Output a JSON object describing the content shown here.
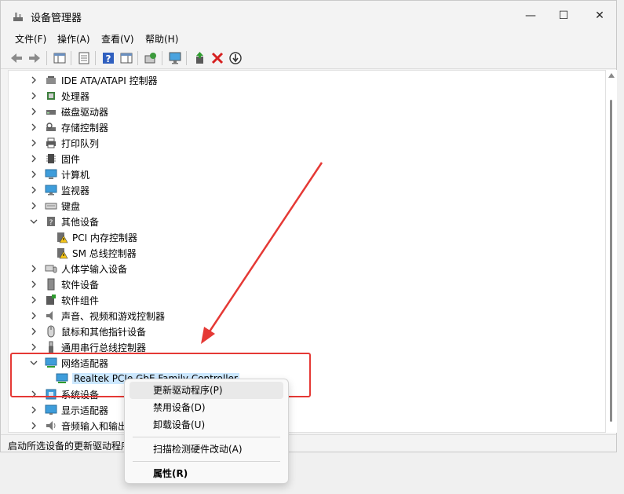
{
  "window": {
    "title": "设备管理器",
    "minimize": "—",
    "maximize": "☐",
    "close": "✕"
  },
  "menu": [
    "文件(F)",
    "操作(A)",
    "查看(V)",
    "帮助(H)"
  ],
  "tree": [
    {
      "label": "IDE ATA/ATAPI 控制器",
      "icon": "ide-controller-icon",
      "level": 0,
      "expanded": false
    },
    {
      "label": "处理器",
      "icon": "processor-icon",
      "level": 0,
      "expanded": false
    },
    {
      "label": "磁盘驱动器",
      "icon": "disk-drive-icon",
      "level": 0,
      "expanded": false
    },
    {
      "label": "存储控制器",
      "icon": "storage-controller-icon",
      "level": 0,
      "expanded": false
    },
    {
      "label": "打印队列",
      "icon": "printer-icon",
      "level": 0,
      "expanded": false
    },
    {
      "label": "固件",
      "icon": "firmware-icon",
      "level": 0,
      "expanded": false
    },
    {
      "label": "计算机",
      "icon": "computer-icon",
      "level": 0,
      "expanded": false
    },
    {
      "label": "监视器",
      "icon": "monitor-icon",
      "level": 0,
      "expanded": false
    },
    {
      "label": "键盘",
      "icon": "keyboard-icon",
      "level": 0,
      "expanded": false
    },
    {
      "label": "其他设备",
      "icon": "other-devices-icon",
      "level": 0,
      "expanded": true
    },
    {
      "label": "PCI 内存控制器",
      "icon": "warning-device-icon",
      "level": 1
    },
    {
      "label": "SM 总线控制器",
      "icon": "warning-device-icon",
      "level": 1
    },
    {
      "label": "人体学输入设备",
      "icon": "hid-icon",
      "level": 0,
      "expanded": false
    },
    {
      "label": "软件设备",
      "icon": "software-device-icon",
      "level": 0,
      "expanded": false
    },
    {
      "label": "软件组件",
      "icon": "software-component-icon",
      "level": 0,
      "expanded": false
    },
    {
      "label": "声音、视频和游戏控制器",
      "icon": "speaker-icon",
      "level": 0,
      "expanded": false
    },
    {
      "label": "鼠标和其他指针设备",
      "icon": "mouse-icon",
      "level": 0,
      "expanded": false
    },
    {
      "label": "通用串行总线控制器",
      "icon": "usb-icon",
      "level": 0,
      "expanded": false
    },
    {
      "label": "网络适配器",
      "icon": "network-adapter-icon",
      "level": 0,
      "expanded": true
    },
    {
      "label": "Realtek PCIe GbE Family Controller",
      "icon": "network-adapter-icon",
      "level": 1,
      "selected": true
    },
    {
      "label": "系统设备",
      "icon": "system-device-icon",
      "level": 0,
      "expanded": false
    },
    {
      "label": "显示适配器",
      "icon": "display-adapter-icon",
      "level": 0,
      "expanded": false
    },
    {
      "label": "音频输入和输出",
      "icon": "audio-io-icon",
      "level": 0,
      "expanded": false
    }
  ],
  "status": "启动所选设备的更新驱动程序向导。",
  "context_menu": {
    "update": "更新驱动程序(P)",
    "disable": "禁用设备(D)",
    "uninstall": "卸载设备(U)",
    "scan": "扫描检测硬件改动(A)",
    "properties": "属性(R)"
  },
  "colors": {
    "annotation": "#e53935",
    "selection": "#cce8ff",
    "accent": "#0078d4"
  }
}
